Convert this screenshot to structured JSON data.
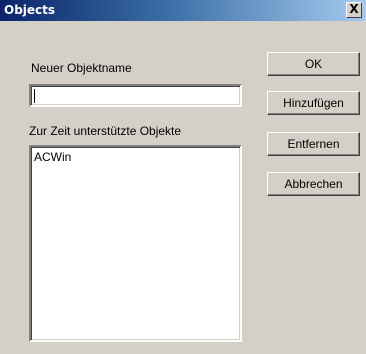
{
  "window": {
    "title": "Objects",
    "close_glyph": "X"
  },
  "form": {
    "name_label": "Neuer Objektname",
    "name_value": "",
    "supported_label": "Zur Zeit unterstützte Objekte",
    "supported_items": [
      "ACWin"
    ]
  },
  "buttons": {
    "ok": "OK",
    "add": "Hinzufügen",
    "remove": "Entfernen",
    "cancel": "Abbrechen"
  },
  "colors": {
    "dialog_face": "#d4d0c8",
    "titlebar_start": "#0a246a",
    "titlebar_end": "#a6caf0"
  }
}
